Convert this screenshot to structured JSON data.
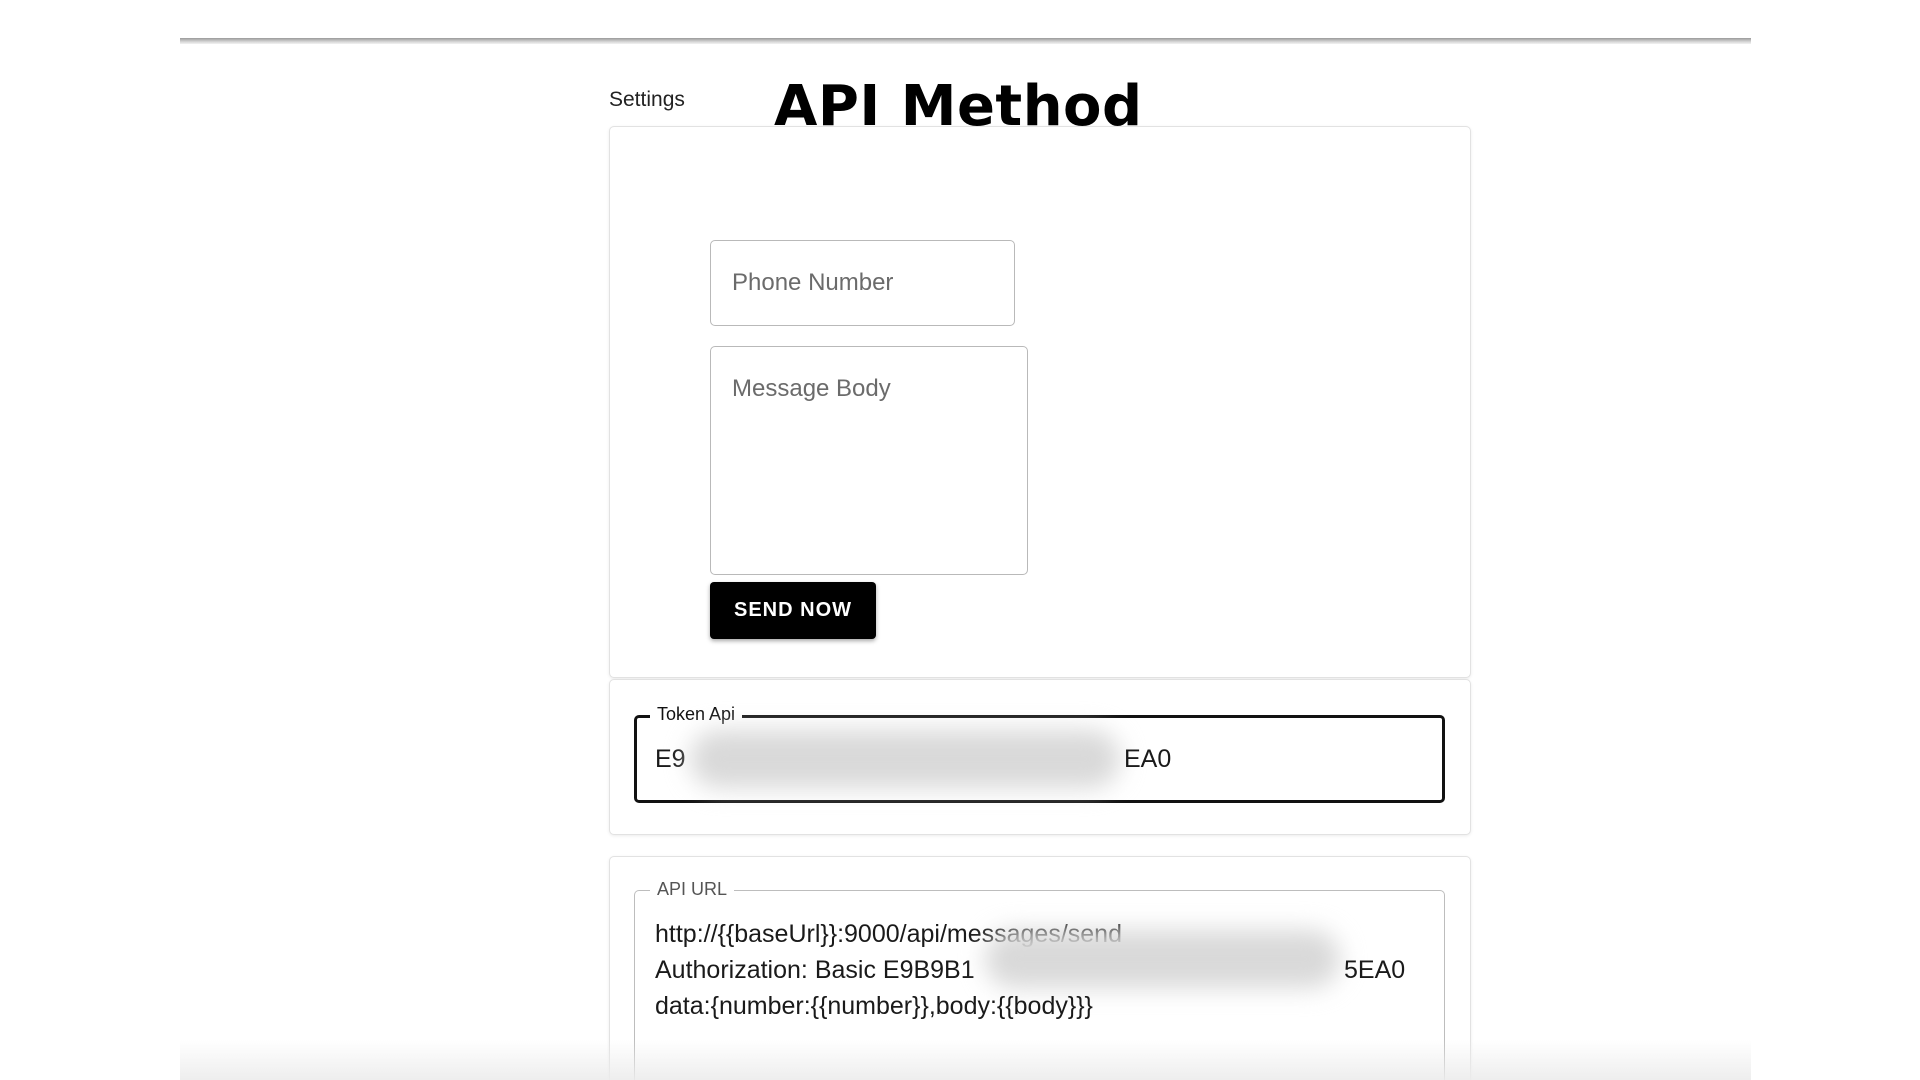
{
  "header": {
    "settings_label": "Settings",
    "title": "API Method"
  },
  "send_form": {
    "phone_placeholder": "Phone Number",
    "message_placeholder": "Message Body",
    "send_button": "SEND NOW"
  },
  "token": {
    "label": "Token Api",
    "value_start": "E9",
    "value_end": "EA0"
  },
  "api_url": {
    "label": "API URL",
    "line1": "http://{{baseUrl}}:9000/api/messages/send",
    "line2_start": "Authorization: Basic E9B9B1",
    "line2_end": "5EA0",
    "line3": "data:{number:{{number}},body:{{body}}}"
  }
}
